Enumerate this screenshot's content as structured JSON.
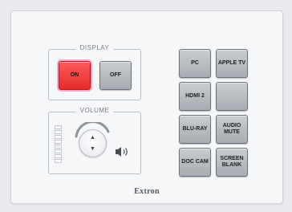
{
  "display": {
    "title": "DISPLAY",
    "on_label": "ON",
    "off_label": "OFF"
  },
  "volume": {
    "title": "VOLUME",
    "up_glyph": "▲",
    "down_glyph": "▼",
    "level_segments": 8
  },
  "sources": [
    {
      "label": "PC"
    },
    {
      "label": "APPLE TV"
    },
    {
      "label": "HDMI 2"
    },
    {
      "label": ""
    },
    {
      "label": "BLU-RAY"
    },
    {
      "label": "AUDIO MUTE"
    },
    {
      "label": "DOC CAM"
    },
    {
      "label": "SCREEN BLANK"
    }
  ],
  "brand": "Extron",
  "colors": {
    "on_active": "#e83a3a",
    "button_gray": "#b5b9be",
    "panel": "#f6f7f8"
  },
  "icons": {
    "volume_up": "triangle-up",
    "volume_down": "triangle-down",
    "speaker": "speaker-icon"
  }
}
